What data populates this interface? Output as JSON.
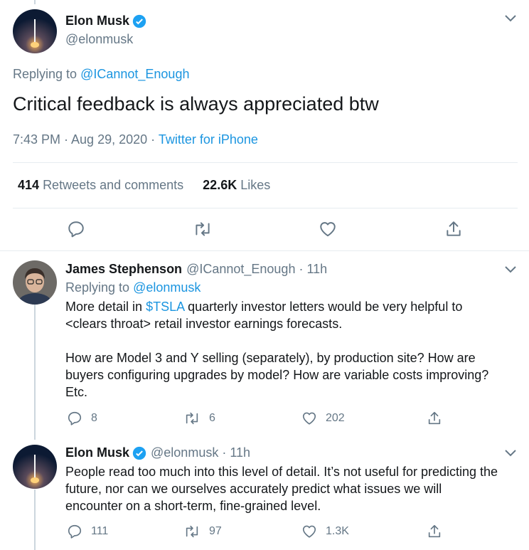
{
  "main_tweet": {
    "author_name": "Elon Musk",
    "author_handle": "@elonmusk",
    "replying_prefix": "Replying to",
    "replying_handle": "@ICannot_Enough",
    "text": "Critical feedback is always appreciated btw",
    "time": "7:43 PM · Aug 29, 2020 ·",
    "source": "Twitter for iPhone",
    "retweets_count": "414",
    "retweets_label": "Retweets and comments",
    "likes_count": "22.6K",
    "likes_label": "Likes"
  },
  "reply1": {
    "author_name": "James Stephenson",
    "author_handle": "@ICannot_Enough",
    "time": "· 11h",
    "replying_prefix": "Replying to",
    "replying_handle": "@elonmusk",
    "line1_before": "More detail in",
    "line1_cashtag": "$TSLA",
    "line1_after": "quarterly investor letters would be very helpful to",
    "line2": "<clears throat> retail investor earnings forecasts.",
    "line3": "How are Model 3 and Y selling (separately), by production site?  How are",
    "line4": "buyers configuring upgrades by model?  How are variable costs improving?",
    "line5": "Etc.",
    "reply_count": "8",
    "retweet_count": "6",
    "like_count": "202"
  },
  "reply2": {
    "author_name": "Elon Musk",
    "author_handle": "@elonmusk",
    "time": "· 11h",
    "line1": "People read too much into this level of detail. It’s not useful for predicting the",
    "line2": "future, nor can we ourselves accurately predict what issues we will",
    "line3": "encounter on a short-term, fine-grained level.",
    "reply_count": "111",
    "retweet_count": "97",
    "like_count": "1.3K"
  },
  "colors": {
    "accent": "#1b95e0",
    "muted": "#657786",
    "text": "#14171a",
    "divider": "#e6ecf0"
  }
}
